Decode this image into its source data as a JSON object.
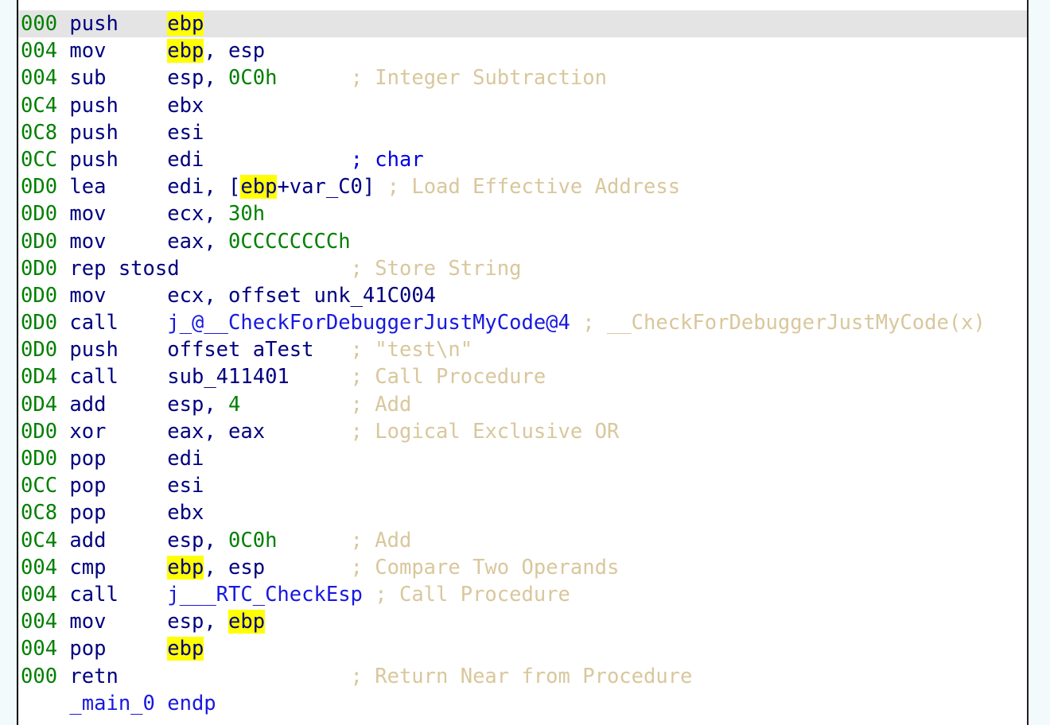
{
  "app": {
    "view": "IDA View-A",
    "kind": "disassembly-listing",
    "procedure": "_main_0",
    "highlighted_identifier": "ebp"
  },
  "colors": {
    "background": "#ffffff",
    "surround": "#f2fafb",
    "border": "#000000",
    "selected_row": "#e4e4e4",
    "address": "#008000",
    "mnemonic": "#000080",
    "operand": "#000080",
    "number": "#008000",
    "code_reference": "#1818e0",
    "auto_comment": "#d9c79c",
    "type_comment": "#0000e6",
    "highlight": "#ffff00"
  },
  "columns": {
    "address_col": 0,
    "mnemonic_col": 4,
    "operand_col": 12,
    "comment_col": 27
  },
  "listing": {
    "lines": [
      {
        "selected": true,
        "address": "000",
        "mnemonic": "push",
        "operands_text": "ebp",
        "comment": "",
        "comment_style": "none"
      },
      {
        "selected": false,
        "address": "004",
        "mnemonic": "mov",
        "operands_text": "ebp, esp",
        "comment": "",
        "comment_style": "none"
      },
      {
        "selected": false,
        "address": "004",
        "mnemonic": "sub",
        "operands_text": "esp, 0C0h",
        "comment": "; Integer Subtraction",
        "comment_style": "auto"
      },
      {
        "selected": false,
        "address": "0C4",
        "mnemonic": "push",
        "operands_text": "ebx",
        "comment": "",
        "comment_style": "none"
      },
      {
        "selected": false,
        "address": "0C8",
        "mnemonic": "push",
        "operands_text": "esi",
        "comment": "",
        "comment_style": "none"
      },
      {
        "selected": false,
        "address": "0CC",
        "mnemonic": "push",
        "operands_text": "edi",
        "comment": "; char",
        "comment_style": "type"
      },
      {
        "selected": false,
        "address": "0D0",
        "mnemonic": "lea",
        "operands_text": "edi, [ebp+var_C0]",
        "comment": "; Load Effective Address",
        "comment_style": "auto"
      },
      {
        "selected": false,
        "address": "0D0",
        "mnemonic": "mov",
        "operands_text": "ecx, 30h",
        "comment": "",
        "comment_style": "none"
      },
      {
        "selected": false,
        "address": "0D0",
        "mnemonic": "mov",
        "operands_text": "eax, 0CCCCCCCCh",
        "comment": "",
        "comment_style": "none"
      },
      {
        "selected": false,
        "address": "0D0",
        "mnemonic": "rep stosd",
        "operands_text": "",
        "comment": "; Store String",
        "comment_style": "auto"
      },
      {
        "selected": false,
        "address": "0D0",
        "mnemonic": "mov",
        "operands_text": "ecx, offset unk_41C004",
        "comment": "",
        "comment_style": "none"
      },
      {
        "selected": false,
        "address": "0D0",
        "mnemonic": "call",
        "operands_text": "j_@__CheckForDebuggerJustMyCode@4",
        "comment": "; __CheckForDebuggerJustMyCode(x)",
        "comment_style": "auto"
      },
      {
        "selected": false,
        "address": "0D0",
        "mnemonic": "push",
        "operands_text": "offset aTest",
        "comment": "; \"test\\n\"",
        "comment_style": "auto"
      },
      {
        "selected": false,
        "address": "0D4",
        "mnemonic": "call",
        "operands_text": "sub_411401",
        "comment": "; Call Procedure",
        "comment_style": "auto"
      },
      {
        "selected": false,
        "address": "0D4",
        "mnemonic": "add",
        "operands_text": "esp, 4",
        "comment": "; Add",
        "comment_style": "auto"
      },
      {
        "selected": false,
        "address": "0D0",
        "mnemonic": "xor",
        "operands_text": "eax, eax",
        "comment": "; Logical Exclusive OR",
        "comment_style": "auto"
      },
      {
        "selected": false,
        "address": "0D0",
        "mnemonic": "pop",
        "operands_text": "edi",
        "comment": "",
        "comment_style": "none"
      },
      {
        "selected": false,
        "address": "0CC",
        "mnemonic": "pop",
        "operands_text": "esi",
        "comment": "",
        "comment_style": "none"
      },
      {
        "selected": false,
        "address": "0C8",
        "mnemonic": "pop",
        "operands_text": "ebx",
        "comment": "",
        "comment_style": "none"
      },
      {
        "selected": false,
        "address": "0C4",
        "mnemonic": "add",
        "operands_text": "esp, 0C0h",
        "comment": "; Add",
        "comment_style": "auto"
      },
      {
        "selected": false,
        "address": "004",
        "mnemonic": "cmp",
        "operands_text": "ebp, esp",
        "comment": "; Compare Two Operands",
        "comment_style": "auto"
      },
      {
        "selected": false,
        "address": "004",
        "mnemonic": "call",
        "operands_text": "j___RTC_CheckEsp",
        "comment": "; Call Procedure",
        "comment_style": "auto"
      },
      {
        "selected": false,
        "address": "004",
        "mnemonic": "mov",
        "operands_text": "esp, ebp",
        "comment": "",
        "comment_style": "none"
      },
      {
        "selected": false,
        "address": "004",
        "mnemonic": "pop",
        "operands_text": "ebp",
        "comment": "",
        "comment_style": "none"
      },
      {
        "selected": false,
        "address": "000",
        "mnemonic": "retn",
        "operands_text": "",
        "comment": "; Return Near from Procedure",
        "comment_style": "auto"
      },
      {
        "selected": false,
        "address": "",
        "mnemonic": "",
        "operands_text": "_main_0 endp",
        "comment": "",
        "comment_style": "none",
        "is_procedure_end": true
      }
    ]
  }
}
